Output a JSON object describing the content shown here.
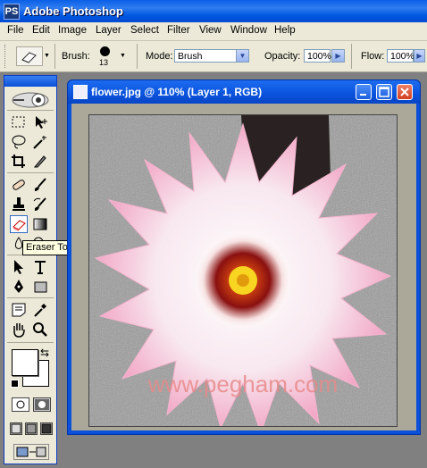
{
  "app": {
    "title": "Adobe Photoshop",
    "logo": "PS"
  },
  "menu": [
    "File",
    "Edit",
    "Image",
    "Layer",
    "Select",
    "Filter",
    "View",
    "Window",
    "Help"
  ],
  "options": {
    "brush_label": "Brush:",
    "brush_size": "13",
    "mode_label": "Mode:",
    "mode_value": "Brush",
    "opacity_label": "Opacity:",
    "opacity_value": "100%",
    "flow_label": "Flow:",
    "flow_value": "100%"
  },
  "tooltip": "Eraser Tool (E)",
  "document": {
    "title": "flower.jpg @ 110% (Layer 1, RGB)",
    "watermark": "www.pegham.com"
  },
  "colors": {
    "xp_blue": "#0a50d8",
    "face": "#ece9d8",
    "close_red": "#e0452a"
  }
}
